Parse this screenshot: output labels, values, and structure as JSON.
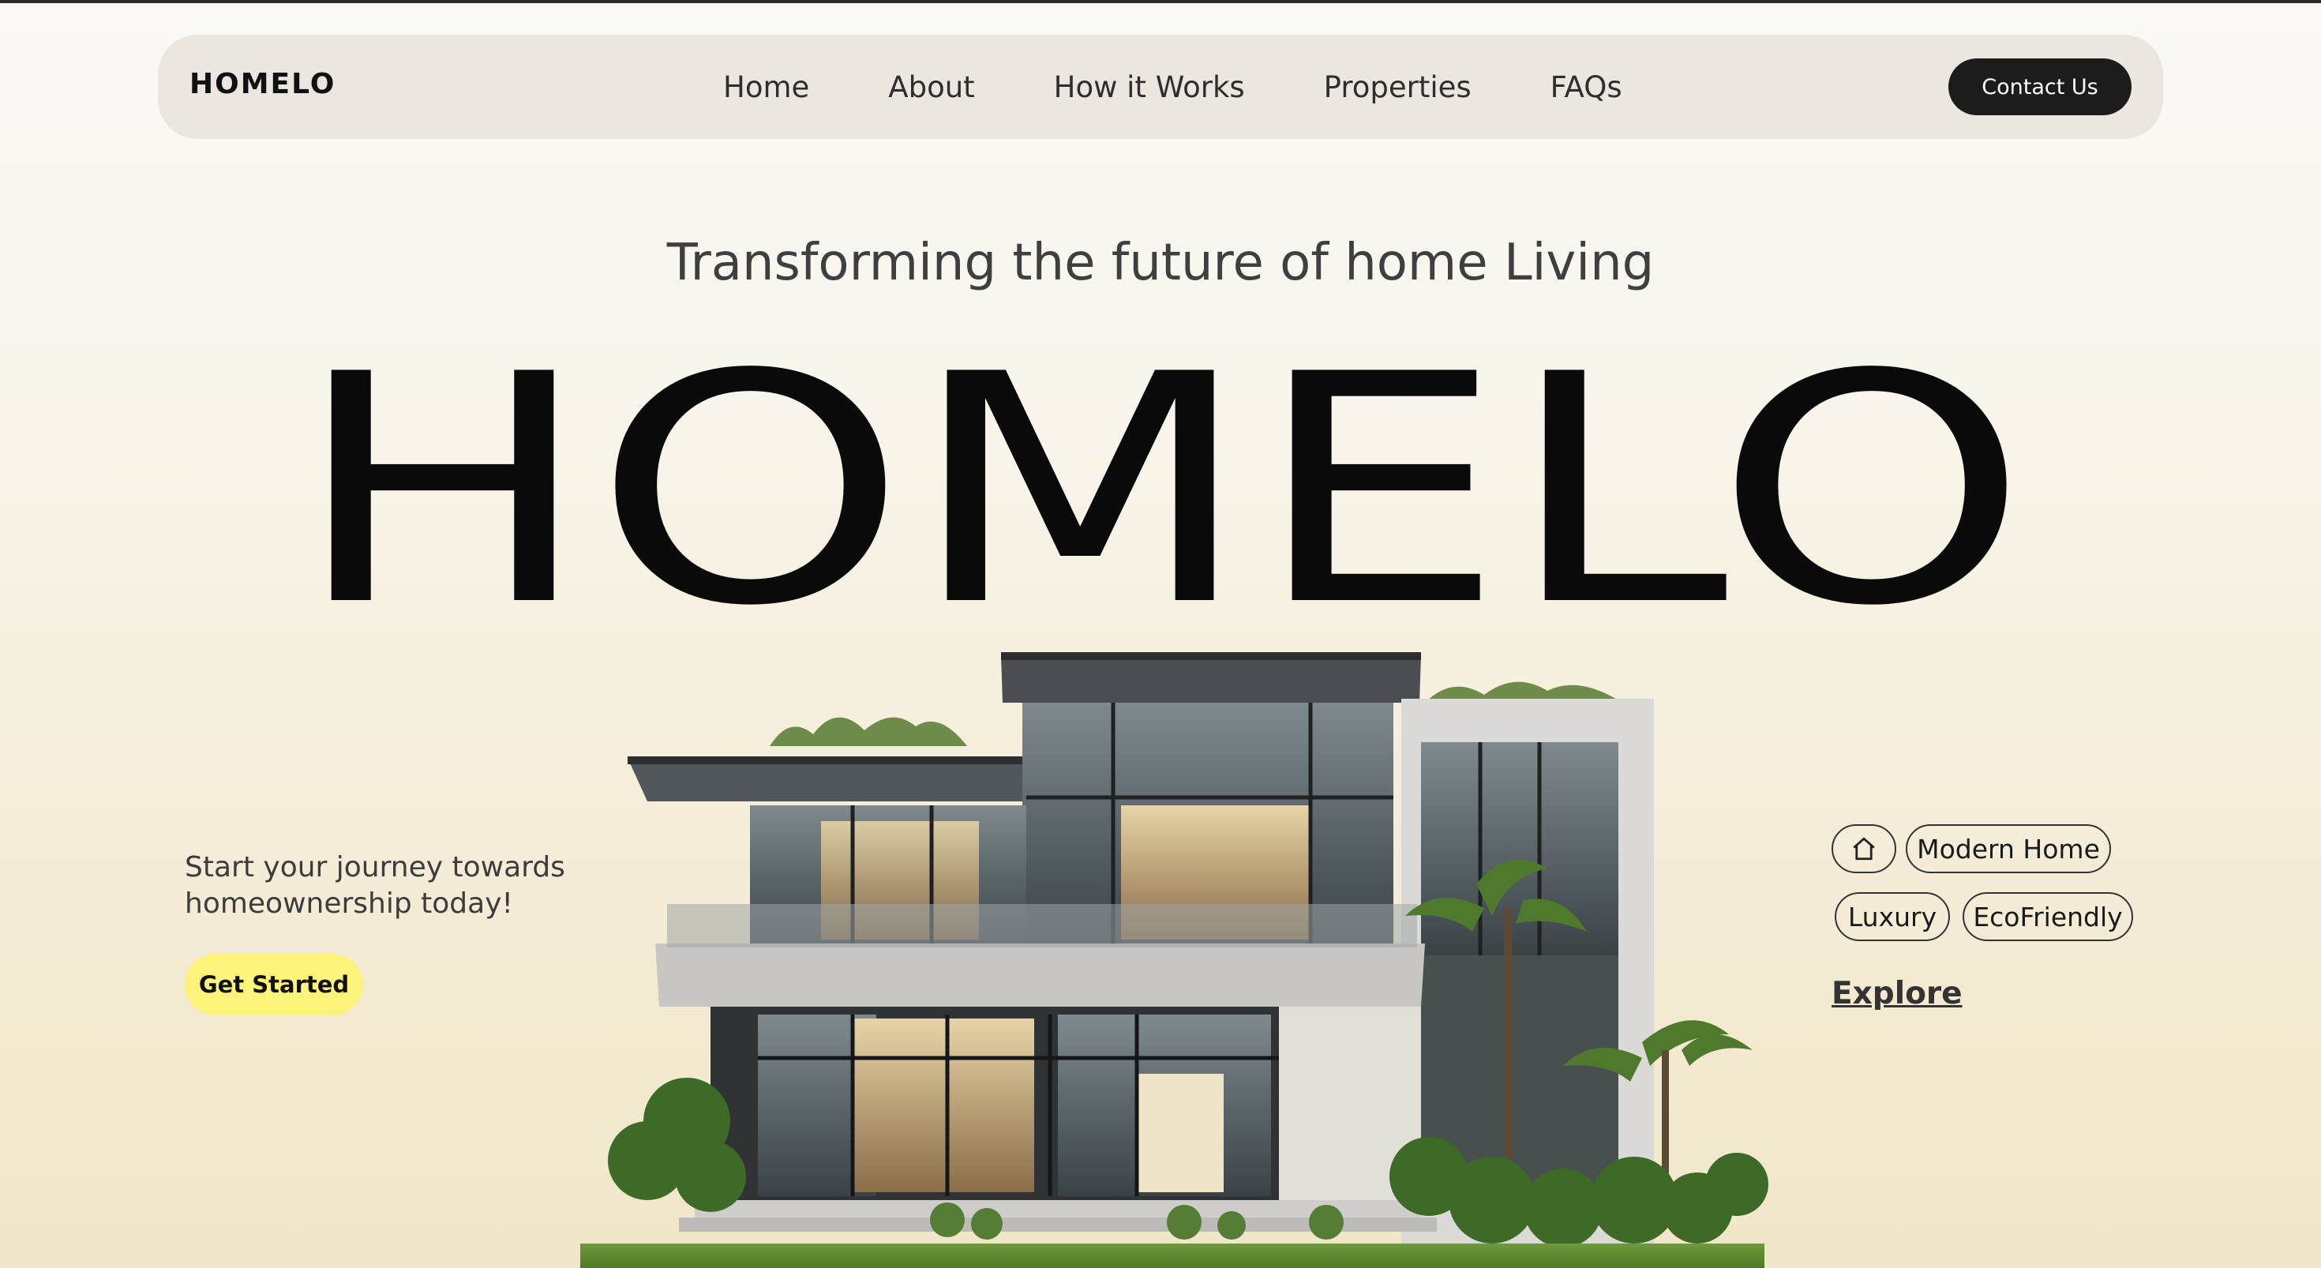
{
  "brand": "HOMELO",
  "nav": {
    "links": [
      "Home",
      "About",
      "How it Works",
      "Properties",
      "FAQs"
    ],
    "contact_label": "Contact Us"
  },
  "hero": {
    "tagline": "Transforming the future of home Living",
    "title": "HOMELO"
  },
  "cta": {
    "text": "Start your journey towards homeownership today!",
    "button_label": "Get Started"
  },
  "tags": {
    "icon": "home-icon",
    "items": [
      "Modern Home",
      "Luxury",
      "EcoFriendly"
    ],
    "explore_label": "Explore"
  },
  "colors": {
    "accent_yellow": "#fbf37a",
    "nav_bg": "#ece6e1",
    "dark": "#1c1c1c"
  }
}
